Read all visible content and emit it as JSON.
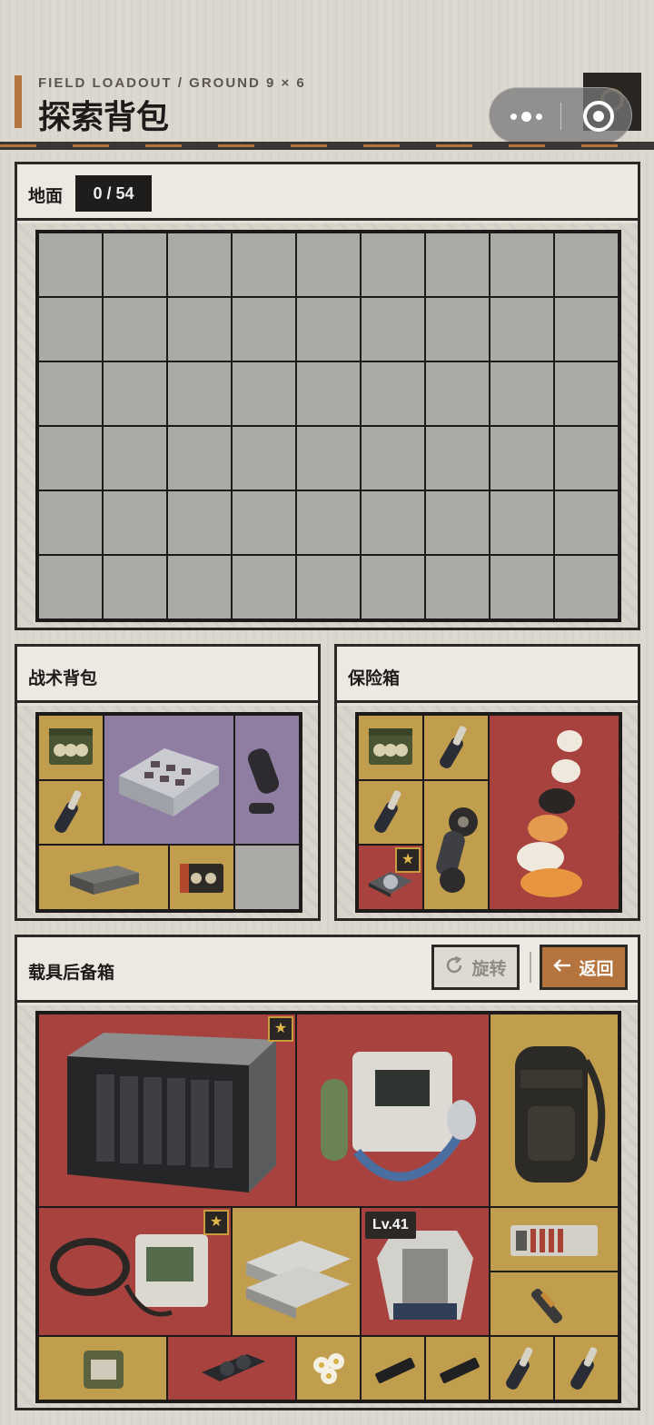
{
  "header": {
    "subtitle": "FIELD LOADOUT / GROUND 9 × 6",
    "title": "探索背包"
  },
  "ground": {
    "title": "地面",
    "counter": "0 / 54",
    "cols": 9,
    "rows": 6
  },
  "tactical_backpack": {
    "title": "战术背包",
    "items": [
      "ammo-crate-icon",
      "grip-parts-icon",
      "storage-box-icon",
      "scope-parts-icon",
      "router-icon",
      "cassette-icon"
    ]
  },
  "safe_box": {
    "title": "保险箱",
    "items": [
      "ammo-crate-icon",
      "grip-parts-icon",
      "grip-parts-icon",
      "film-roll-icon",
      "hard-drive-icon",
      "cat-stack-icon"
    ]
  },
  "vehicle_trunk": {
    "title": "载具后备箱",
    "rotate_label": "旋转",
    "back_label": "返回",
    "level_label": "Lv.41",
    "items": [
      "server-rack-icon",
      "oxygen-machine-icon",
      "backpack-icon",
      "helmet-device-icon",
      "silver-plates-icon",
      "body-armor-icon",
      "circuit-board-icon",
      "injector-icon",
      "field-ration-icon",
      "gpu-icon",
      "flower-icon",
      "ssd-icon",
      "ssd-icon",
      "grip-parts-icon",
      "grip-parts-icon"
    ]
  },
  "colors": {
    "accent": "#b5733d",
    "rarity_gold": "#c19d4e",
    "rarity_red": "#a8423f",
    "rarity_purple": "#8f7ea1"
  }
}
